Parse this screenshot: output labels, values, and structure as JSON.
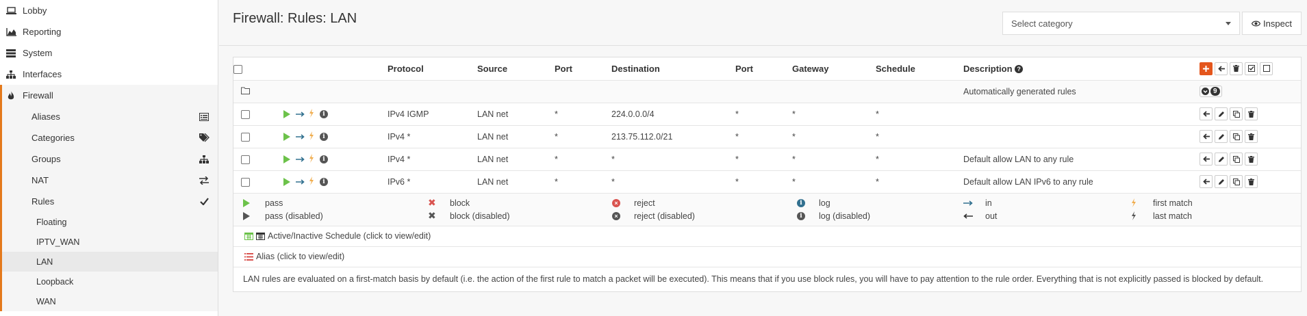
{
  "sidebar": {
    "top_items": [
      {
        "label": "Lobby",
        "icon": "laptop-icon"
      },
      {
        "label": "Reporting",
        "icon": "area-chart-icon"
      },
      {
        "label": "System",
        "icon": "server-icon"
      },
      {
        "label": "Interfaces",
        "icon": "sitemap-icon"
      },
      {
        "label": "Firewall",
        "icon": "fire-icon"
      }
    ],
    "firewall_items": [
      {
        "label": "Aliases",
        "icon": "list-alt-icon"
      },
      {
        "label": "Categories",
        "icon": "tags-icon"
      },
      {
        "label": "Groups",
        "icon": "sitemap-icon"
      },
      {
        "label": "NAT",
        "icon": "exchange-icon"
      },
      {
        "label": "Rules",
        "icon": "check-icon"
      }
    ],
    "rules_items": [
      "Floating",
      "IPTV_WAN",
      "LAN",
      "Loopback",
      "WAN"
    ]
  },
  "header": {
    "title": "Firewall: Rules: LAN",
    "category_placeholder": "Select category",
    "inspect_label": "Inspect"
  },
  "table": {
    "headers": {
      "protocol": "Protocol",
      "source": "Source",
      "port": "Port",
      "destination": "Destination",
      "port2": "Port",
      "gateway": "Gateway",
      "schedule": "Schedule",
      "description": "Description"
    },
    "auto_rules": {
      "description": "Automatically generated rules",
      "count": "9"
    },
    "rows": [
      {
        "protocol": "IPv4 IGMP",
        "source": "LAN net",
        "port": "*",
        "destination": "224.0.0.0/4",
        "port2": "*",
        "gateway": "*",
        "schedule": "*",
        "description": ""
      },
      {
        "protocol": "IPv4 *",
        "source": "LAN net",
        "port": "*",
        "destination": "213.75.112.0/21",
        "port2": "*",
        "gateway": "*",
        "schedule": "*",
        "description": ""
      },
      {
        "protocol": "IPv4 *",
        "source": "LAN net",
        "port": "*",
        "destination": "*",
        "port2": "*",
        "gateway": "*",
        "schedule": "*",
        "description": "Default allow LAN to any rule"
      },
      {
        "protocol": "IPv6 *",
        "source": "LAN net",
        "port": "*",
        "destination": "*",
        "port2": "*",
        "gateway": "*",
        "schedule": "*",
        "description": "Default allow LAN IPv6 to any rule"
      }
    ]
  },
  "legend": {
    "pass": "pass",
    "pass_disabled": "pass (disabled)",
    "block": "block",
    "block_disabled": "block (disabled)",
    "reject": "reject",
    "reject_disabled": "reject (disabled)",
    "log": "log",
    "log_disabled": "log (disabled)",
    "in": "in",
    "out": "out",
    "first_match": "first match",
    "last_match": "last match"
  },
  "schedule_bar": "Active/Inactive Schedule (click to view/edit)",
  "alias_bar": "Alias (click to view/edit)",
  "note": "LAN rules are evaluated on a first-match basis by default (i.e. the action of the first rule to match a packet will be executed). This means that if you use block rules, you will have to pay attention to the rule order. Everything that is not explicitly passed is blocked by default.",
  "colors": {
    "accent": "#e4791c",
    "pass": "#6cc24a",
    "block": "#d9534f",
    "add": "#e4561c"
  }
}
